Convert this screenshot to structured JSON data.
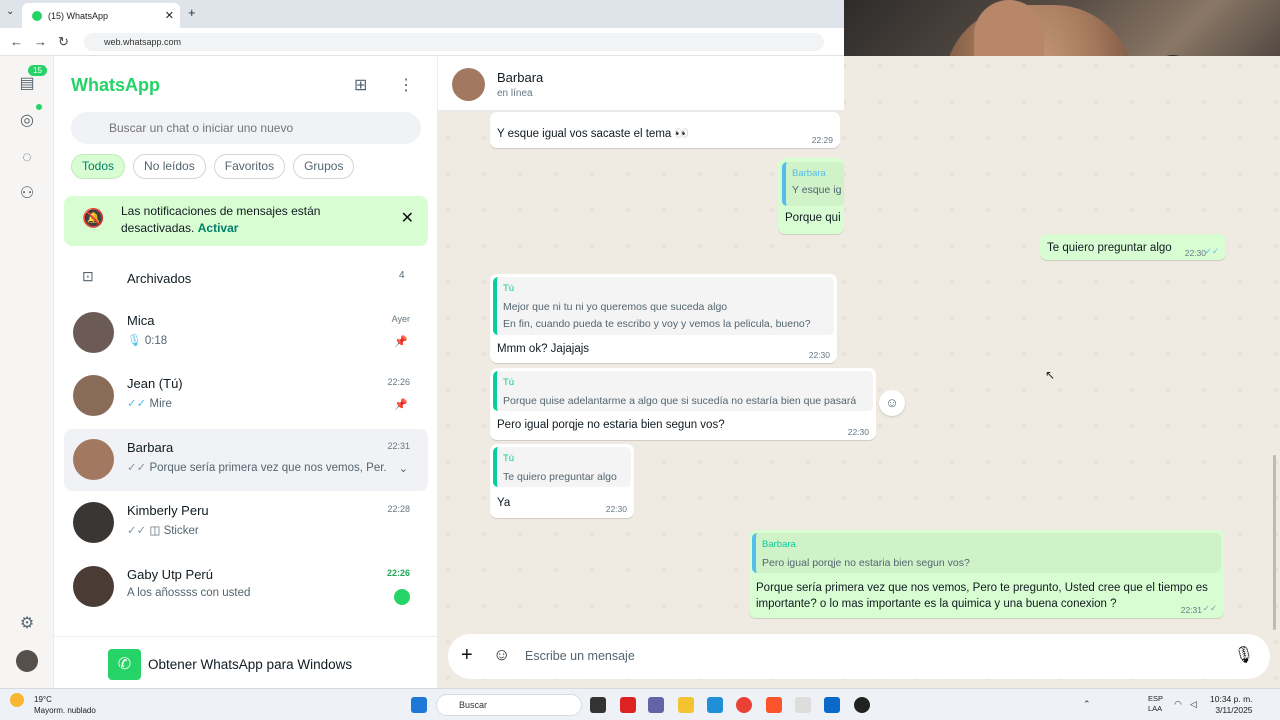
{
  "browser": {
    "tab_title": "(15) WhatsApp",
    "url": "web.whatsapp.com"
  },
  "rail": {
    "chats_badge": "15"
  },
  "sidebar": {
    "brand": "WhatsApp",
    "search_placeholder": "Buscar un chat o iniciar uno nuevo",
    "filters": [
      "Todos",
      "No leídos",
      "Favoritos",
      "Grupos"
    ],
    "notification": {
      "text": "Las notificaciones de mensajes están desactivadas.",
      "action": "Activar"
    },
    "archived": {
      "label": "Archivados",
      "count": "4"
    },
    "chats": [
      {
        "name": "Mica",
        "time": "Ayer",
        "preview": "0:18"
      },
      {
        "name": "Jean (Tú)",
        "time": "22:26",
        "preview": "Mire"
      },
      {
        "name": "Barbara",
        "time": "22:31",
        "preview": "Porque sería primera vez que nos vemos,  Per..."
      },
      {
        "name": "Kimberly Peru",
        "time": "22:28",
        "preview": "Sticker"
      },
      {
        "name": "Gaby Utp Perú",
        "time": "22:26",
        "preview": "A los añossss con usted"
      }
    ],
    "get_windows": "Obtener WhatsApp para Windows"
  },
  "conversation": {
    "contact_name": "Barbara",
    "contact_status": "en línea",
    "messages": [
      {
        "body": "Y esque igual vos sacaste el tema 👀",
        "time": "22:29"
      },
      {
        "quote_author": "Barbara",
        "quote_line": "Y esque ig",
        "body": "Porque qui"
      },
      {
        "body": "Te quiero preguntar algo",
        "time": "22:30"
      },
      {
        "quote_author": "Tú",
        "quote_lines": [
          "Mejor que ni tu ni yo queremos que suceda algo",
          "En fin,  cuando pueda te escribo y voy  y vemos la pelicula, bueno?"
        ],
        "body": "Mmm ok? Jajajajs",
        "time": "22:30"
      },
      {
        "quote_author": "Tú",
        "quote_lines": [
          "Porque quise adelantarme a algo que si sucedía no estaría bien que pasará"
        ],
        "body": "Pero igual porqje no estaria bien segun vos?",
        "time": "22:30"
      },
      {
        "quote_author": "Tú",
        "quote_lines": [
          "Te quiero preguntar algo"
        ],
        "body": "Ya",
        "time": "22:30"
      },
      {
        "quote_author": "Barbara",
        "quote_lines": [
          "Pero igual porqje no estaria bien segun vos?"
        ],
        "body_lines": [
          "Porque sería primera vez que nos vemos,  Pero te pregunto, Usted cree que el tiempo es",
          "importante? o lo mas importante es la quimica  y una buena conexion ?"
        ],
        "time": "22:31"
      }
    ],
    "composer_placeholder": "Escribe un mensaje"
  },
  "taskbar": {
    "weather_temp": "19°C",
    "weather_desc": "Mayorm. nublado",
    "search_label": "Buscar",
    "lang_top": "ESP",
    "lang_bottom": "LAA",
    "time": "10:34 p. m.",
    "date": "3/11/2025"
  },
  "colors": {
    "brand_green": "#25d366",
    "outgoing_bubble": "#d9fdd3",
    "wallpaper": "#efeae2"
  }
}
